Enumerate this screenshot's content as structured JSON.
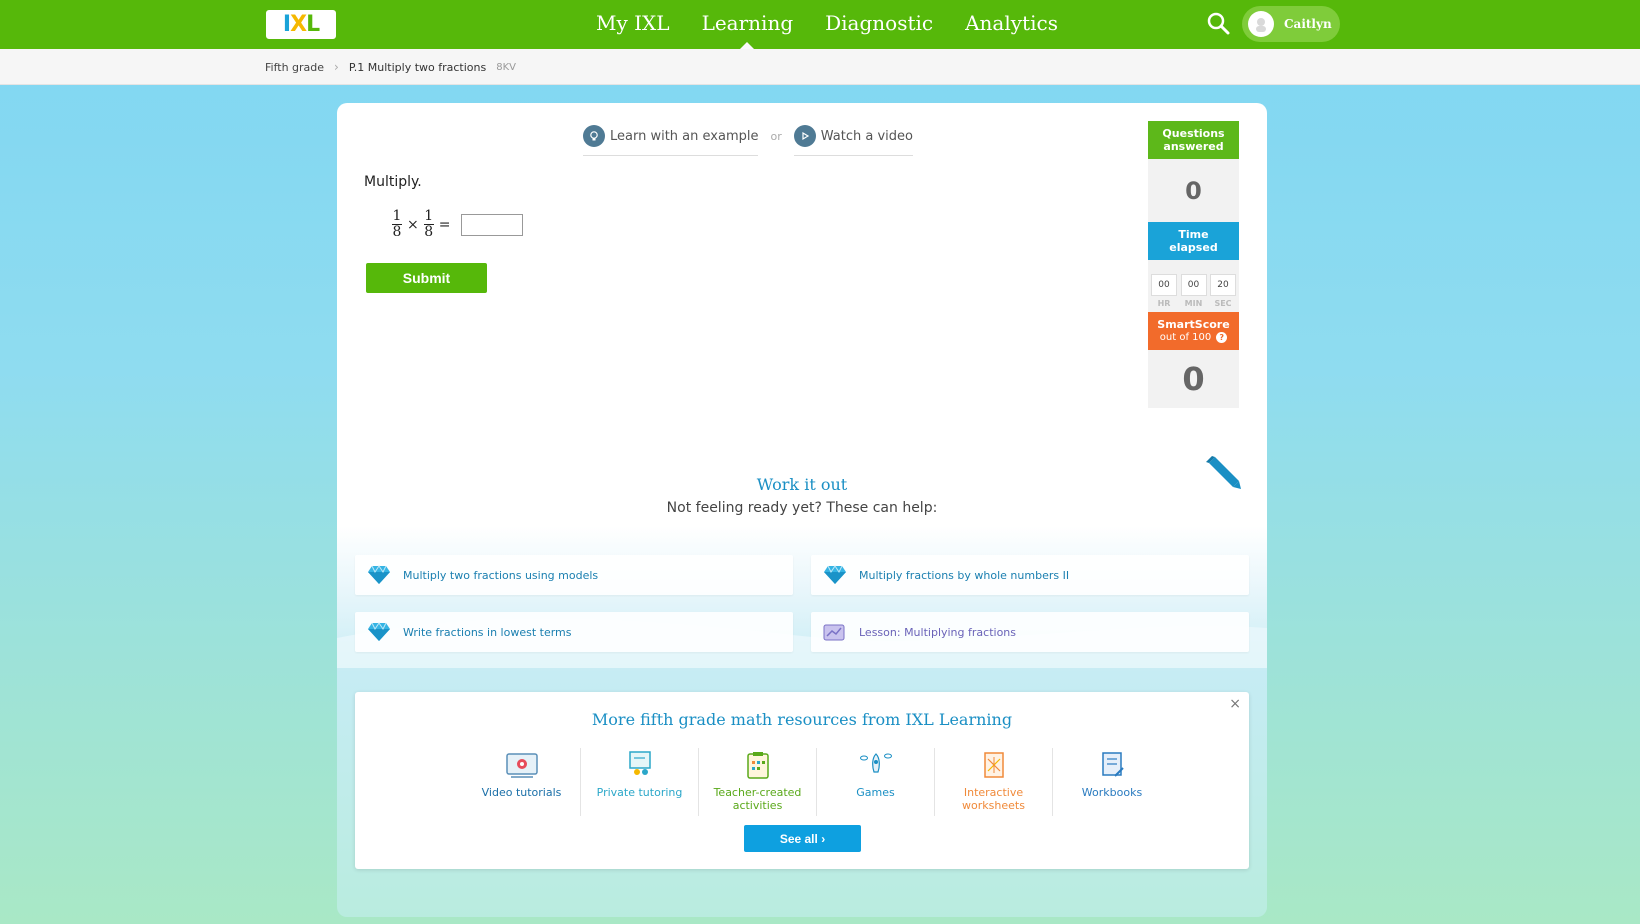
{
  "nav": {
    "logo": {
      "p1": "I",
      "p2": "X",
      "p3": "L"
    },
    "links": [
      "My IXL",
      "Learning",
      "Diagnostic",
      "Analytics"
    ],
    "active": "Learning",
    "user": "Caitlyn"
  },
  "breadcrumb": {
    "grade": "Fifth grade",
    "skill": "P.1 Multiply two fractions",
    "code": "8KV"
  },
  "helpers": {
    "example": "Learn with an example",
    "or": "or",
    "video": "Watch a video"
  },
  "question": {
    "prompt": "Multiply.",
    "frac1": {
      "num": "1",
      "den": "8"
    },
    "frac2": {
      "num": "1",
      "den": "8"
    },
    "times": "×",
    "equals": "=",
    "submit": "Submit"
  },
  "stats": {
    "questions_label_1": "Questions",
    "questions_label_2": "answered",
    "questions_value": "0",
    "time_label_1": "Time",
    "time_label_2": "elapsed",
    "hr": "00",
    "min": "00",
    "sec": "20",
    "hr_label": "HR",
    "min_label": "MIN",
    "sec_label": "SEC",
    "smartscore_label": "SmartScore",
    "smartscore_sub": "out of 100",
    "smartscore_value": "0"
  },
  "work": {
    "title": "Work it out",
    "subtitle": "Not feeling ready yet? These can help:",
    "suggestions": [
      "Multiply two fractions using models",
      "Multiply fractions by whole numbers II",
      "Write fractions in lowest terms",
      "Lesson: Multiplying fractions"
    ]
  },
  "resources": {
    "title": "More fifth grade math resources from IXL Learning",
    "close": "×",
    "items": [
      {
        "line1": "Video tutorials",
        "line2": "",
        "color": "#1a6fa8"
      },
      {
        "line1": "Private tutoring",
        "line2": "",
        "color": "#2ba7c9"
      },
      {
        "line1": "Teacher-created",
        "line2": "activities",
        "color": "#5aa91a"
      },
      {
        "line1": "Games",
        "line2": "",
        "color": "#1a8fc4"
      },
      {
        "line1": "Interactive",
        "line2": "worksheets",
        "color": "#f08a3a"
      },
      {
        "line1": "Workbooks",
        "line2": "",
        "color": "#2a7bc0"
      }
    ],
    "see_all": "See all"
  },
  "colors": {
    "brand_green": "#56b80a",
    "blue": "#1aa3d8",
    "orange": "#f26b2b"
  }
}
